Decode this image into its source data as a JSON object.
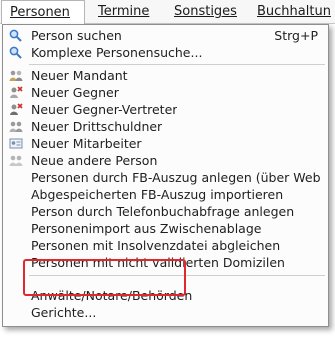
{
  "menubar": {
    "items": [
      {
        "label": "Personen",
        "active": true
      },
      {
        "label": "Termine",
        "active": false
      },
      {
        "label": "Sonstiges",
        "active": false
      },
      {
        "label": "Buchhaltun",
        "active": false
      }
    ]
  },
  "menu": {
    "items": [
      {
        "label": "Person suchen",
        "shortcut": "Strg+P",
        "icon": "search-icon"
      },
      {
        "label": "Komplexe Personensuche...",
        "icon": "search-icon"
      },
      {
        "label": "Neuer Mandant",
        "icon": "people-icon"
      },
      {
        "label": "Neuer Gegner",
        "icon": "people-icon"
      },
      {
        "label": "Neuer Gegner-Vertreter",
        "icon": "people-icon"
      },
      {
        "label": "Neuer Drittschuldner",
        "icon": "people-icon"
      },
      {
        "label": "Neuer Mitarbeiter",
        "icon": "id-card-icon"
      },
      {
        "label": "Neue andere Person",
        "icon": "people-icon"
      },
      {
        "label": "Personen durch FB-Auszug anlegen (über Webb..."
      },
      {
        "label": "Abgespeicherten FB-Auszug importieren"
      },
      {
        "label": "Person durch Telefonbuchabfrage anlegen"
      },
      {
        "label": "Personenimport aus Zwischenablage"
      },
      {
        "label": "Personen mit Insolvenzdatei abgleichen"
      },
      {
        "label": "Personen mit nicht validierten Domizilen"
      },
      {
        "label": "Anwälte/Notare/Behörden"
      },
      {
        "label": "Gerichte..."
      }
    ]
  },
  "colors": {
    "highlight_border": "#e0282e",
    "icon_blue": "#3a78c9"
  }
}
